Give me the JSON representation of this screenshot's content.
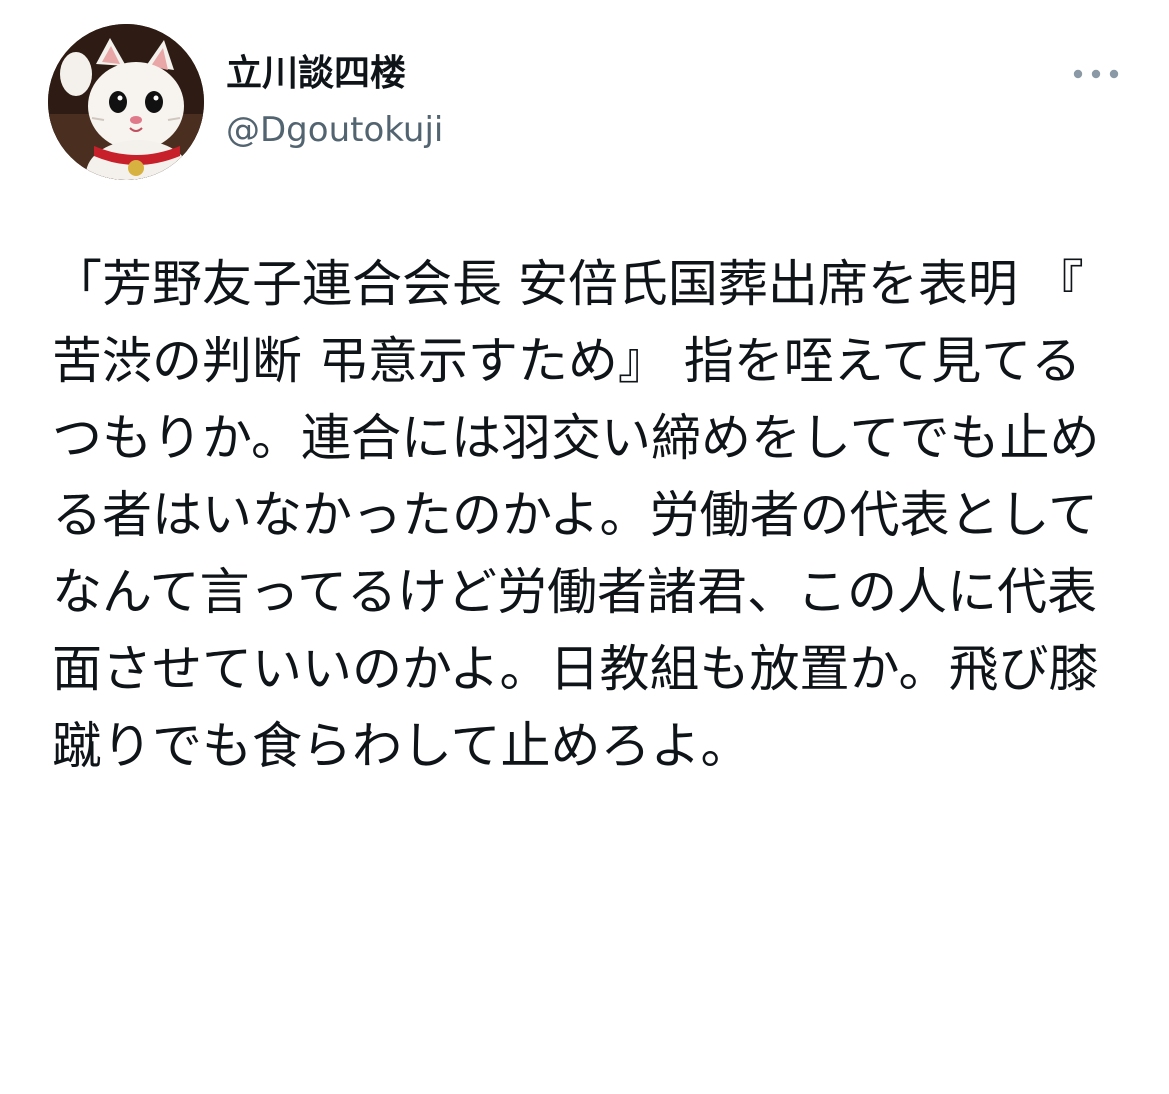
{
  "author": {
    "display_name": "立川談四楼",
    "handle": "@Dgoutokuji",
    "avatar_icon": "maneki-neko-avatar"
  },
  "more_icon": "more-horizontal-icon",
  "colors": {
    "text": "#0f1419",
    "secondary": "#536471",
    "background": "#ffffff"
  },
  "tweet": {
    "text": "「芳野友子連合会長 安倍氏国葬出席を表明 『苦渋の判断 弔意示すため』 指を咥えて見てるつもりか。連合には羽交い締めをしてでも止める者はいなかったのかよ。労働者の代表としてなんて言ってるけど労働者諸君、この人に代表面させていいのかよ。日教組も放置か。飛び膝蹴りでも食らわして止めろよ。"
  }
}
